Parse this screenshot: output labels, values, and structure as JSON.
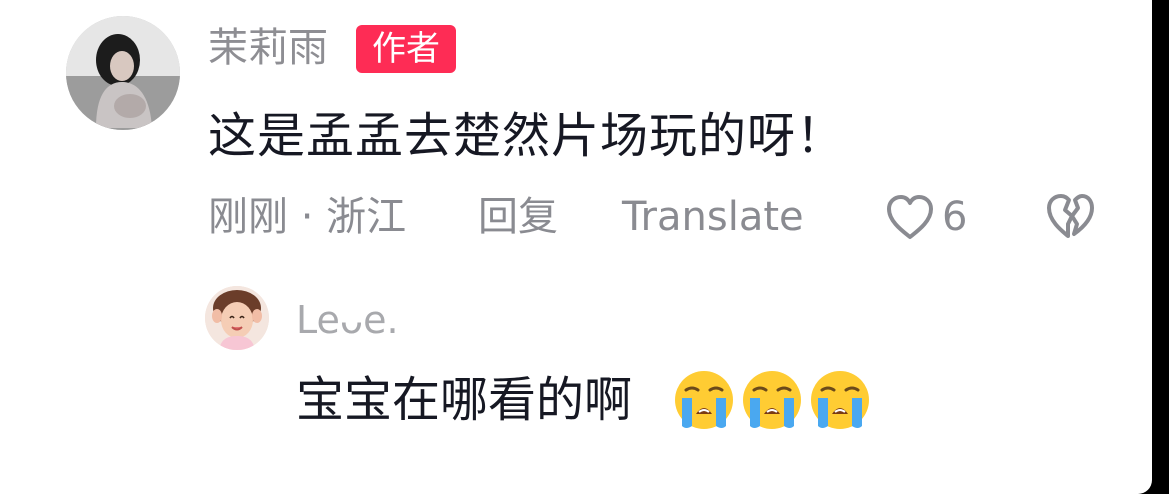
{
  "comment": {
    "author_name": "茉莉雨",
    "author_badge": "作者",
    "text": "这是孟孟去楚然片场玩的呀！",
    "time_location": "刚刚 · 浙江",
    "reply_label": "回复",
    "translate_label": "Translate",
    "like_count": "6",
    "avatar": "user-avatar-photo",
    "like_icon": "heart-outline-icon",
    "dislike_icon": "broken-heart-icon"
  },
  "reply": {
    "author_name": "Leᴗe.",
    "text": "宝宝在哪看的啊",
    "emoji": [
      "loudly-crying-face-emoji",
      "loudly-crying-face-emoji",
      "loudly-crying-face-emoji"
    ],
    "avatar": "child-avatar-photo"
  },
  "colors": {
    "badge": "#fe2c55",
    "primary_text": "#161823",
    "secondary_text": "#8a8b91"
  }
}
